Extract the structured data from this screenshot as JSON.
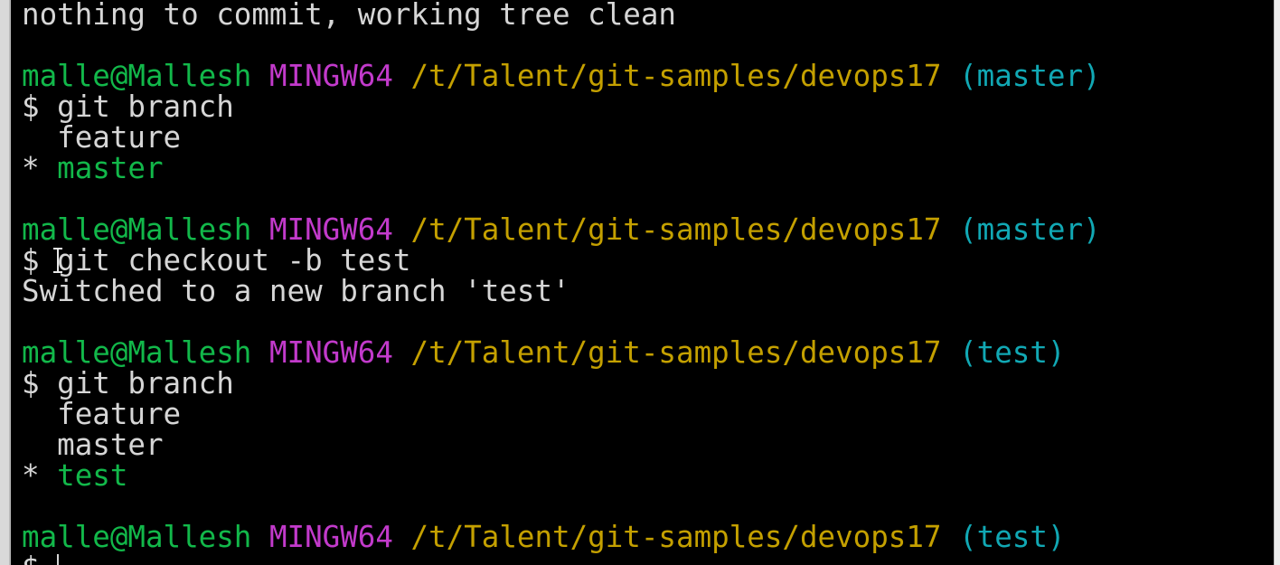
{
  "terminal": {
    "lines": [
      {
        "type": "output",
        "text": "nothing to commit, working tree clean"
      },
      {
        "type": "blank"
      },
      {
        "type": "prompt",
        "user": "malle@Mallesh",
        "host": "MINGW64",
        "path": "/t/Talent/git-samples/devops17",
        "branch": "(master)"
      },
      {
        "type": "command",
        "text": "$ git branch"
      },
      {
        "type": "branch",
        "marker": "  ",
        "name": "feature",
        "current": false
      },
      {
        "type": "branch",
        "marker": "* ",
        "name": "master",
        "current": true
      },
      {
        "type": "blank"
      },
      {
        "type": "prompt",
        "user": "malle@Mallesh",
        "host": "MINGW64",
        "path": "/t/Talent/git-samples/devops17",
        "branch": "(master)"
      },
      {
        "type": "command",
        "text": "$ git checkout -b test"
      },
      {
        "type": "output",
        "text": "Switched to a new branch 'test'"
      },
      {
        "type": "blank"
      },
      {
        "type": "prompt",
        "user": "malle@Mallesh",
        "host": "MINGW64",
        "path": "/t/Talent/git-samples/devops17",
        "branch": "(test)"
      },
      {
        "type": "command",
        "text": "$ git branch"
      },
      {
        "type": "branch",
        "marker": "  ",
        "name": "feature",
        "current": false
      },
      {
        "type": "branch",
        "marker": "  ",
        "name": "master",
        "current": false
      },
      {
        "type": "branch",
        "marker": "* ",
        "name": "test",
        "current": true
      },
      {
        "type": "blank"
      },
      {
        "type": "prompt",
        "user": "malle@Mallesh",
        "host": "MINGW64",
        "path": "/t/Talent/git-samples/devops17",
        "branch": "(test)"
      },
      {
        "type": "input",
        "text": "$ "
      }
    ]
  },
  "colors": {
    "background": "#000000",
    "text": "#d6d6d6",
    "user": "#12b84a",
    "host": "#c23acb",
    "path": "#c4a000",
    "branch": "#11a8b4",
    "current_branch": "#12b84a"
  }
}
